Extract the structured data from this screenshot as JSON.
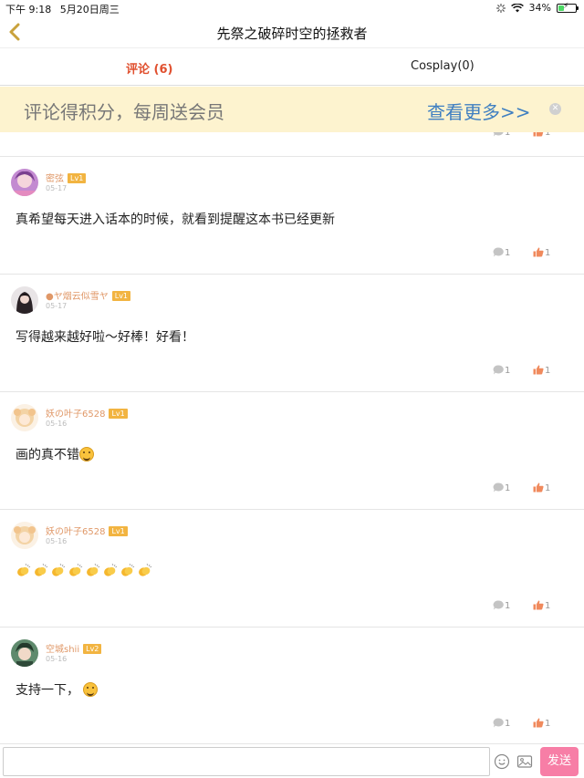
{
  "status_bar": {
    "time": "下午 9:18",
    "date": "5月20日周三",
    "battery": "34%",
    "battery_level": 0.34
  },
  "nav": {
    "title": "先祭之破碎时空的拯救者"
  },
  "tabs": [
    {
      "label": "评论 (6)",
      "active": true
    },
    {
      "label": "Cosplay(0)",
      "active": false
    }
  ],
  "banner": {
    "text": "评论得积分，每周送会员",
    "more": "查看更多>>"
  },
  "prev_comment": {
    "reply_count": "1",
    "like_count": "1"
  },
  "comments": [
    {
      "username": "密弦",
      "level": "Lv1",
      "date": "05-17",
      "content": "真希望每天进入话本的时候，就看到提醒这本书已经更新",
      "reply_count": "1",
      "like_count": "1"
    },
    {
      "username": "●ヤ烟云似雪ヤ",
      "level": "Lv1",
      "date": "05-17",
      "content": "写得越来越好啦～好棒！好看！",
      "reply_count": "1",
      "like_count": "1"
    },
    {
      "username": "妖の叶子6528",
      "level": "Lv1",
      "date": "05-16",
      "content": "画的真不错",
      "reply_count": "1",
      "like_count": "1"
    },
    {
      "username": "妖の叶子6528",
      "level": "Lv1",
      "date": "05-16",
      "content": "",
      "reply_count": "1",
      "like_count": "1"
    },
    {
      "username": "空城shii",
      "level": "Lv2",
      "date": "05-16",
      "content": "支持一下，",
      "reply_count": "1",
      "like_count": "1"
    }
  ],
  "input_bar": {
    "placeholder": "",
    "send_label": "发送"
  },
  "colors": {
    "accent": "#e0502f",
    "banner_bg": "#fdf3cf",
    "link": "#3f7fc1",
    "level_badge": "#f2b441",
    "like": "#f08a5d",
    "send_button": "#f77ea6",
    "username": "#e09868"
  }
}
